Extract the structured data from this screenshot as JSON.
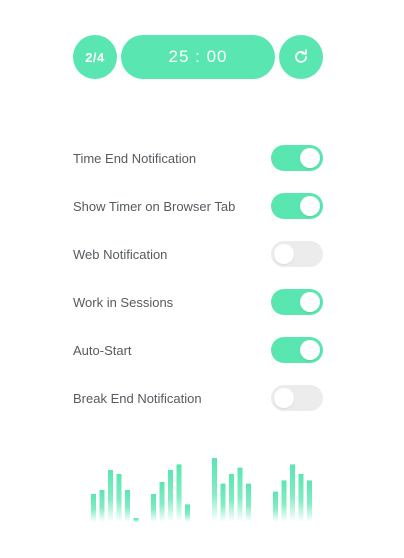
{
  "timer": {
    "session_label": "2/4",
    "time_label": "25 : 00",
    "reset_icon": "refresh-icon",
    "accent": "#5ae6b0"
  },
  "settings": [
    {
      "label": "Time End Notification",
      "on": true
    },
    {
      "label": "Show Timer on Browser Tab",
      "on": true
    },
    {
      "label": "Web Notification",
      "on": false
    },
    {
      "label": "Work in Sessions",
      "on": true
    },
    {
      "label": "Auto-Start",
      "on": true
    },
    {
      "label": "Break End Notification",
      "on": false
    }
  ],
  "visualizer": {
    "bar_color": "#5ae6b0",
    "groups": [
      [
        0.35,
        0.4,
        0.65,
        0.6,
        0.4,
        0.05
      ],
      [
        0.35,
        0.5,
        0.65,
        0.72,
        0.22
      ],
      [
        0.8,
        0.48,
        0.6,
        0.68,
        0.48
      ],
      [
        0.38,
        0.52,
        0.72,
        0.6,
        0.52
      ]
    ]
  }
}
